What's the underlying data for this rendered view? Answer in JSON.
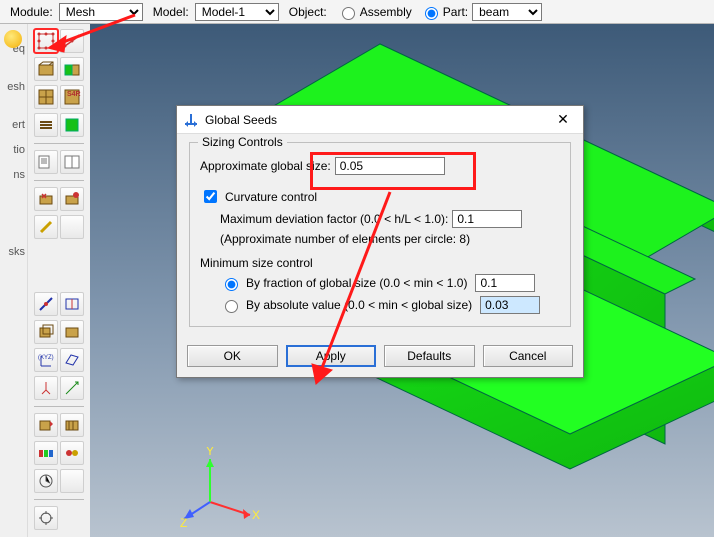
{
  "topbar": {
    "module_label": "Module:",
    "module_value": "Mesh",
    "model_label": "Model:",
    "model_value": "Model-1",
    "object_label": "Object:",
    "assembly_label": "Assembly",
    "part_label": "Part:",
    "part_value": "beam",
    "object_choice": "part"
  },
  "leftcrop": [
    "",
    "eq",
    "",
    "esh",
    "",
    "ert",
    "tio",
    "ns",
    "",
    "",
    "",
    "",
    "sks"
  ],
  "triad": {
    "x": "X",
    "y": "Y",
    "z": "Z"
  },
  "dialog": {
    "title": "Global Seeds",
    "group1_legend": "Sizing Controls",
    "approx_label": "Approximate global size:",
    "approx_value": "0.05",
    "curvature_checked": true,
    "curvature_label": "Curvature control",
    "maxdev_label": "Maximum deviation factor (0.0 < h/L < 1.0):",
    "maxdev_value": "0.1",
    "approx_num_circle": "(Approximate number of elements per circle: 8)",
    "group2_legend": "Minimum size control",
    "min_mode": "fraction",
    "frac_label": "By fraction of global size   (0.0 < min < 1.0)",
    "frac_value": "0.1",
    "abs_label": "By absolute value   (0.0 < min < global size)",
    "abs_value": "0.03",
    "btn_ok": "OK",
    "btn_apply": "Apply",
    "btn_defaults": "Defaults",
    "btn_cancel": "Cancel"
  },
  "tool_names": [
    [
      "seed-part",
      "seed-edges"
    ],
    [
      "mesh-part",
      "mesh-region"
    ],
    [
      "element-type",
      "mesh-controls"
    ],
    [
      "assign-stack",
      "verify-mesh"
    ],
    [
      "query",
      "mesh-stats"
    ],
    [
      "delete-mesh",
      "edit-mesh"
    ]
  ],
  "tool_names_b": [
    [
      "partition-edge",
      "partition-face"
    ],
    [
      "partition-cell",
      "virtual-topo"
    ],
    [
      "datum-csys",
      "datum-plane"
    ],
    [
      "datum-axis",
      "datum-point"
    ],
    [
      "swept-mesh",
      "orient-stack"
    ],
    [
      "color-code",
      "display-group"
    ],
    [
      "mesh-quality",
      "misc-tool"
    ],
    [
      "plugins",
      ""
    ]
  ]
}
